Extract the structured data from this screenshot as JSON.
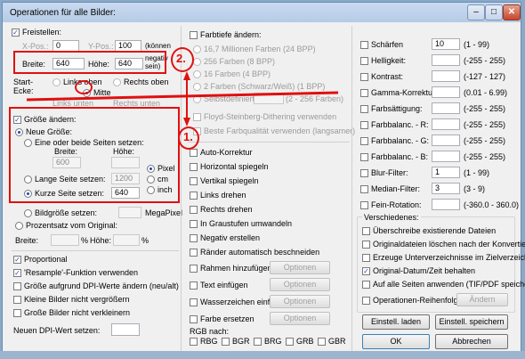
{
  "window": {
    "title": "Operationen für alle Bilder:"
  },
  "left": {
    "freistellen": {
      "label": "Freistellen:",
      "checked": true
    },
    "xpos": {
      "label": "X-Pos.:",
      "value": "0"
    },
    "ypos": {
      "label": "Y-Pos.:",
      "value": "100"
    },
    "koennen": "(können",
    "breite": {
      "label": "Breite:",
      "value": "640"
    },
    "hoehe": {
      "label": "Höhe:",
      "value": "640"
    },
    "negativ": "negativ",
    "sein": "sein)",
    "start_ecke": "Start-",
    "ecke": "Ecke:",
    "links_oben": "Links oben",
    "rechts_oben": "Rechts oben",
    "mitte": "Mitte",
    "links_unten": "Links unten",
    "rechts_unten": "Rechts unten",
    "groesse_aendern": {
      "label": "Größe ändern:",
      "checked": true
    },
    "neue_groesse": "Neue Größe:",
    "eine_oder_beide": "Eine oder beide Seiten setzen:",
    "breite_lbl": "Breite:",
    "hoehe_lbl": "Höhe:",
    "breite_val": "600",
    "hoehe_val": "",
    "lange_seite": {
      "label": "Lange Seite setzen:",
      "value": "1200"
    },
    "kurze_seite": {
      "label": "Kurze Seite setzen:",
      "value": "640"
    },
    "units": [
      "Pixel",
      "cm",
      "inch"
    ],
    "bildgroesse": {
      "label": "Bildgröße setzen:",
      "unit": "MegaPixel"
    },
    "prozentsatz": "Prozentsatz vom Original:",
    "breite_pct": "Breite:",
    "hoehe_pct": "Höhe:",
    "pct": "%",
    "checks": [
      {
        "label": "Proportional",
        "checked": true
      },
      {
        "label": "'Resample'-Funktion verwenden",
        "checked": true
      },
      {
        "label": "Größe aufgrund DPI-Werte ändern (neu/alt)",
        "checked": false
      },
      {
        "label": "Kleine Bilder nicht vergrößern",
        "checked": false
      },
      {
        "label": "Große Bilder nicht verkleinern",
        "checked": false
      }
    ],
    "dpi": {
      "label": "Neuen DPI-Wert setzen:",
      "value": ""
    }
  },
  "middle": {
    "farbtiefe": {
      "label": "Farbtiefe ändern:",
      "checked": false
    },
    "depths": [
      "16,7 Millionen Farben (24 BPP)",
      "256 Farben (8 BPP)",
      "16 Farben (4 BPP)",
      "2 Farben (Schwarz/Weiß) (1 BPP)"
    ],
    "selbst": {
      "label": "Selbstdefiniert:",
      "range": "(2 - 256 Farben)"
    },
    "floyd": "Floyd-Steinberg-Dithering verwenden",
    "graustufen": "Beste Farbqualität verwenden (langsamer)",
    "checks": [
      {
        "label": "Auto-Korrektur"
      },
      {
        "label": "Horizontal spiegeln"
      },
      {
        "label": "Vertikal spiegeln"
      },
      {
        "label": "Links drehen"
      },
      {
        "label": "Rechts drehen"
      },
      {
        "label": "In Graustufen umwandeln"
      },
      {
        "label": "Negativ erstellen"
      },
      {
        "label": "Ränder automatisch beschneiden"
      }
    ],
    "opt_checks": [
      {
        "label": "Rahmen hinzufügen",
        "btn": "Optionen"
      },
      {
        "label": "Text einfügen",
        "btn": "Optionen"
      },
      {
        "label": "Wasserzeichen einf.",
        "btn": "Optionen"
      },
      {
        "label": "Farbe ersetzen",
        "btn": "Optionen"
      }
    ],
    "rgb_label": "RGB nach:",
    "rgb": [
      "RBG",
      "BGR",
      "BRG",
      "GRB",
      "GBR"
    ]
  },
  "right": {
    "adjust": [
      {
        "label": "Schärfen",
        "value": "10",
        "range": "(1 - 99)"
      },
      {
        "label": "Helligkeit:",
        "value": "",
        "range": "(-255 - 255)"
      },
      {
        "label": "Kontrast:",
        "value": "",
        "range": "(-127 - 127)"
      },
      {
        "label": "Gamma-Korrektur:",
        "value": "",
        "range": "(0.01 - 6.99)"
      },
      {
        "label": "Farbsättigung:",
        "value": "",
        "range": "(-255 - 255)"
      },
      {
        "label": "Farbbalanc. - R:",
        "value": "",
        "range": "(-255 - 255)"
      },
      {
        "label": "Farbbalanc. - G:",
        "value": "",
        "range": "(-255 - 255)"
      },
      {
        "label": "Farbbalanc. - B:",
        "value": "",
        "range": "(-255 - 255)"
      },
      {
        "label": "Blur-Filter:",
        "value": "1",
        "range": "(1 - 99)"
      },
      {
        "label": "Median-Filter:",
        "value": "3",
        "range": "(3 - 9)"
      },
      {
        "label": "Fein-Rotation:",
        "value": "",
        "range": "(-360.0 - 360.0)"
      }
    ],
    "verschiedenes": "Verschiedenes:",
    "misc": [
      {
        "label": "Überschreibe existierende Dateien",
        "checked": false
      },
      {
        "label": "Originaldateien löschen nach der Konvertier.",
        "checked": false
      },
      {
        "label": "Erzeuge Unterverzeichnisse im Zielverzeichn.",
        "checked": false
      },
      {
        "label": "Original-Datum/Zeit behalten",
        "checked": true
      },
      {
        "label": "Auf alle Seiten anwenden (TIF/PDF speichern)",
        "checked": false
      }
    ],
    "reihenfolge": {
      "label": "Operationen-Reihenfolge",
      "btn": "Ändern"
    },
    "buttons": {
      "laden": "Einstell. laden",
      "speichern": "Einstell. speichern",
      "ok": "OK",
      "abbrechen": "Abbrechen"
    }
  },
  "annotations": {
    "step1": "1.",
    "step2": "2.",
    "color": "#e01010"
  }
}
